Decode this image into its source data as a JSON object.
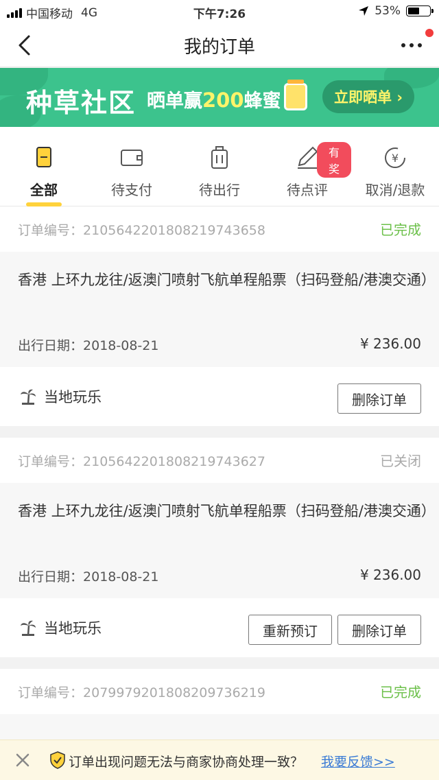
{
  "status_bar": {
    "carrier": "中国移动",
    "network": "4G",
    "time": "下午7:26",
    "battery_text": "53%",
    "battery_level": 0.53
  },
  "nav": {
    "title": "我的订单",
    "back_icon": "chevron-left-icon",
    "more_icon": "more-dots-icon"
  },
  "banner": {
    "main_text": "种草社区",
    "sub_prefix": "晒单赢",
    "sub_number": "200",
    "sub_suffix": "蜂蜜",
    "cta_label": "立即晒单 ›",
    "colors": {
      "background": "#3cc38d",
      "accent": "#fff46a"
    }
  },
  "tabs": [
    {
      "label": "全部",
      "icon": "list-icon",
      "active": true
    },
    {
      "label": "待支付",
      "icon": "wallet-icon",
      "active": false
    },
    {
      "label": "待出行",
      "icon": "luggage-icon",
      "active": false
    },
    {
      "label": "待点评",
      "icon": "pen-icon",
      "active": false,
      "badge": "有奖"
    },
    {
      "label": "取消/退款",
      "icon": "refund-icon",
      "active": false
    }
  ],
  "orders": [
    {
      "number_label": "订单编号：",
      "number": "210564220180821974365 8",
      "status": "已完成",
      "status_color": "#6cc04a",
      "title": "香港 上环九龙往/返澳门喷射飞航单程船票（扫码登船/港澳交通）",
      "date_label": "出行日期：",
      "date": "2018-08-21",
      "price": "¥ 236.00",
      "category": "当地玩乐",
      "buttons": [
        "删除订单"
      ]
    },
    {
      "number_label": "订单编号：",
      "number": "2105642201808219743627",
      "status": "已关闭",
      "status_color": "#aaaaaa",
      "title": "香港 上环九龙往/返澳门喷射飞航单程船票（扫码登船/港澳交通）",
      "date_label": "出行日期：",
      "date": "2018-08-21",
      "price": "¥ 236.00",
      "category": "当地玩乐",
      "buttons": [
        "重新预订",
        "删除订单"
      ]
    },
    {
      "number_label": "订单编号：",
      "number": "2079979201808209736219",
      "status": "已完成",
      "status_color": "#6cc04a"
    }
  ],
  "notice": {
    "text": "订单出现问题无法与商家协商处理一致？",
    "link": "我要反馈>>"
  }
}
